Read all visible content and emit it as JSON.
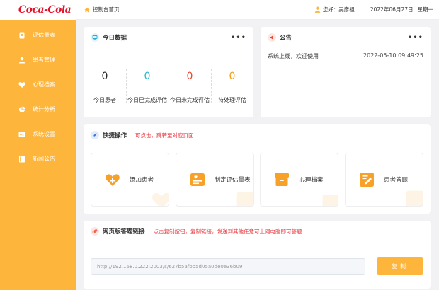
{
  "brand": {
    "logo_text": "Coca-Cola",
    "primary_color": "#fdb53c",
    "accent_red": "#e8323a"
  },
  "sidebar": {
    "items": [
      {
        "label": "评估量表",
        "icon": "scale-doc-icon"
      },
      {
        "label": "患者管理",
        "icon": "user-icon"
      },
      {
        "label": "心理档案",
        "icon": "heart-icon"
      },
      {
        "label": "统计分析",
        "icon": "pie-chart-icon"
      },
      {
        "label": "系统设置",
        "icon": "settings-card-icon"
      },
      {
        "label": "新闻公告",
        "icon": "book-icon"
      }
    ]
  },
  "header": {
    "breadcrumb": "控制台首页",
    "greeting": "您好：吴彦祖",
    "date": "2022年06月27日",
    "weekday": "星期一"
  },
  "today": {
    "title": "今日数据",
    "stats": [
      {
        "value": "0",
        "label": "今日患者",
        "color": "#222222"
      },
      {
        "value": "0",
        "label": "今日已完成评估",
        "color": "#2bb8c8"
      },
      {
        "value": "0",
        "label": "今日未完成评估",
        "color": "#e8472a"
      },
      {
        "value": "0",
        "label": "待处理评估",
        "color": "#f59d0e"
      }
    ]
  },
  "notice": {
    "title": "公告",
    "text": "系统上线，欢迎使用",
    "time": "2022-05-10 09:49:25"
  },
  "quick": {
    "title": "快捷操作",
    "hint": "可点击，跳转至对应页面",
    "items": [
      {
        "label": "添加患者",
        "icon": "add-patient-icon"
      },
      {
        "label": "制定评估量表",
        "icon": "scale-create-icon"
      },
      {
        "label": "心理档案",
        "icon": "archive-box-icon"
      },
      {
        "label": "患者答题",
        "icon": "answer-edit-icon"
      }
    ]
  },
  "weblink": {
    "title": "网页版答题链接",
    "hint": "点击复制按钮，复制链接，发送到其他任意可上网电脑即可答题",
    "url": "http://192.168.0.222:2003/s/627b5afbb5d05a0de0e36b09",
    "copy_label": "复制"
  },
  "more_label": "•••"
}
